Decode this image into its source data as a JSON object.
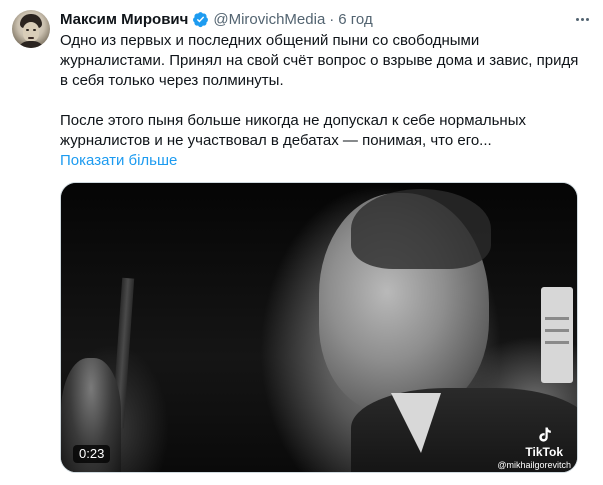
{
  "author": {
    "name": "Максим Мирович",
    "handle": "@MirovichMedia",
    "separator": "·",
    "time": "6 год",
    "verified_color": "#1d9bf0"
  },
  "tweet": {
    "paragraph1": "Одно из первых и последних общений пыни со свободными журналистами. Принял на свой счёт вопрос о взрыве дома и завис, придя в себя только через полминуты.",
    "paragraph2": "После этого пыня больше никогда не допускал к себе нормальных журналистов и не участвовал в дебатах — понимая, что его...",
    "show_more": "Показати більше"
  },
  "media": {
    "duration": "0:23",
    "watermark_brand": "TikTok",
    "watermark_user": "@mikhailgorevitch"
  },
  "icons": {
    "verified": "verified-badge-icon",
    "more": "more-options-icon",
    "tiktok": "tiktok-logo-icon"
  },
  "colors": {
    "link": "#1d9bf0",
    "text": "#0f1419",
    "secondary": "#536471"
  }
}
